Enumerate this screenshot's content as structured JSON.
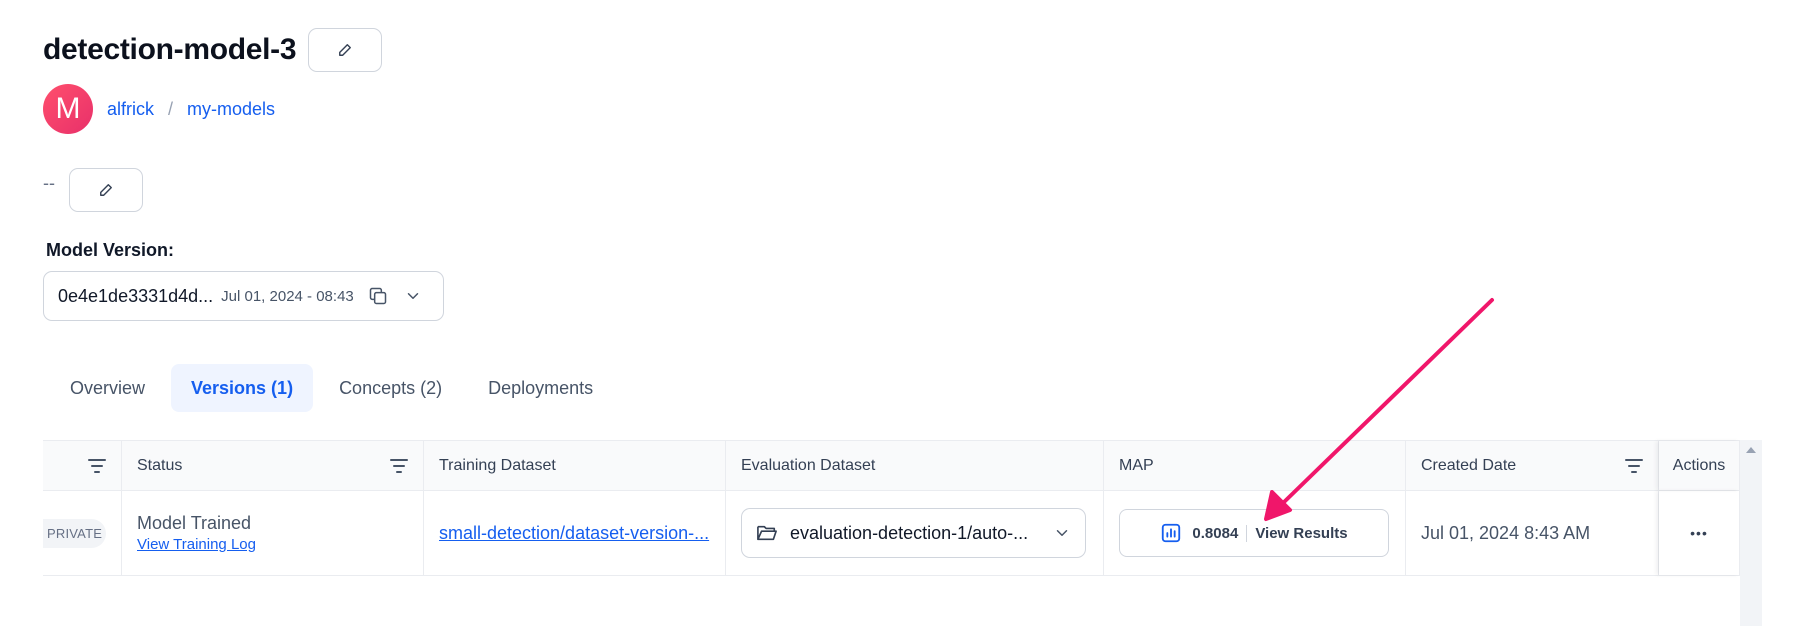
{
  "header": {
    "title": "detection-model-3"
  },
  "owner": {
    "avatar_letter": "M",
    "user": "alfrick",
    "separator": "/",
    "app": "my-models"
  },
  "description": {
    "text": "--"
  },
  "model_version": {
    "label": "Model Version:",
    "id": "0e4e1de3331d4d...",
    "date": "Jul 01, 2024 - 08:43"
  },
  "tabs": [
    {
      "label": "Overview"
    },
    {
      "label": "Versions (1)"
    },
    {
      "label": "Concepts (2)"
    },
    {
      "label": "Deployments"
    }
  ],
  "table": {
    "columns": [
      "Status",
      "Training Dataset",
      "Evaluation Dataset",
      "MAP",
      "Created Date",
      "Actions"
    ],
    "rows": [
      {
        "visibility": "PRIVATE",
        "status": "Model Trained",
        "status_link": "View Training Log",
        "training_dataset": "small-detection/dataset-version-...",
        "evaluation_dataset": "evaluation-detection-1/auto-...",
        "map_value": "0.8084",
        "map_link": "View Results",
        "created": "Jul 01, 2024 8:43 AM",
        "actions": "•••"
      }
    ]
  },
  "colors": {
    "accent": "#155eef",
    "arrow": "#f0166a",
    "avatar": "#e8306a"
  }
}
